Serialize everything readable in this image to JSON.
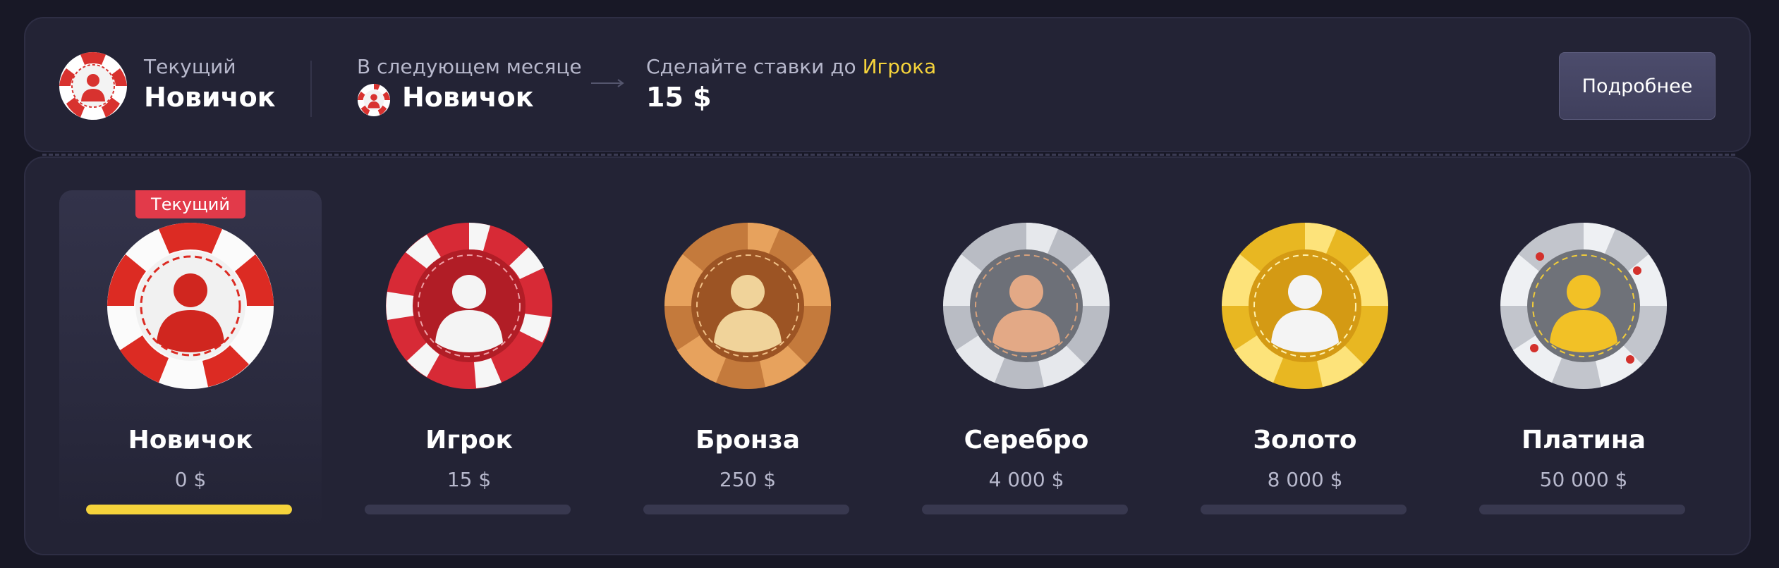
{
  "header": {
    "current_label": "Текущий",
    "current_level": "Новичок",
    "next_month_label": "В следующем месяце",
    "next_month_level": "Новичок",
    "bet_prefix": "Сделайте ставки до ",
    "bet_target": "Игрока",
    "bet_amount": "15 $",
    "more_button": "Подробнее"
  },
  "tiers": [
    {
      "name": "Новичок",
      "amount": "0 $",
      "progress": 1.0,
      "current": true,
      "badge": "Текущий",
      "chip": "red-white-chip"
    },
    {
      "name": "Игрок",
      "amount": "15 $",
      "progress": 0,
      "current": false,
      "chip": "red-chip"
    },
    {
      "name": "Бронза",
      "amount": "250 $",
      "progress": 0,
      "current": false,
      "chip": "bronze-chip"
    },
    {
      "name": "Серебро",
      "amount": "4 000 $",
      "progress": 0,
      "current": false,
      "chip": "silver-chip"
    },
    {
      "name": "Золото",
      "amount": "8 000 $",
      "progress": 0,
      "current": false,
      "chip": "gold-chip"
    },
    {
      "name": "Платина",
      "amount": "50 000 $",
      "progress": 0,
      "current": false,
      "chip": "platinum-chip"
    }
  ],
  "colors": {
    "accent_yellow": "#f5d33b",
    "badge_red": "#e23a4a",
    "panel_bg": "#232335",
    "page_bg": "#181826"
  }
}
